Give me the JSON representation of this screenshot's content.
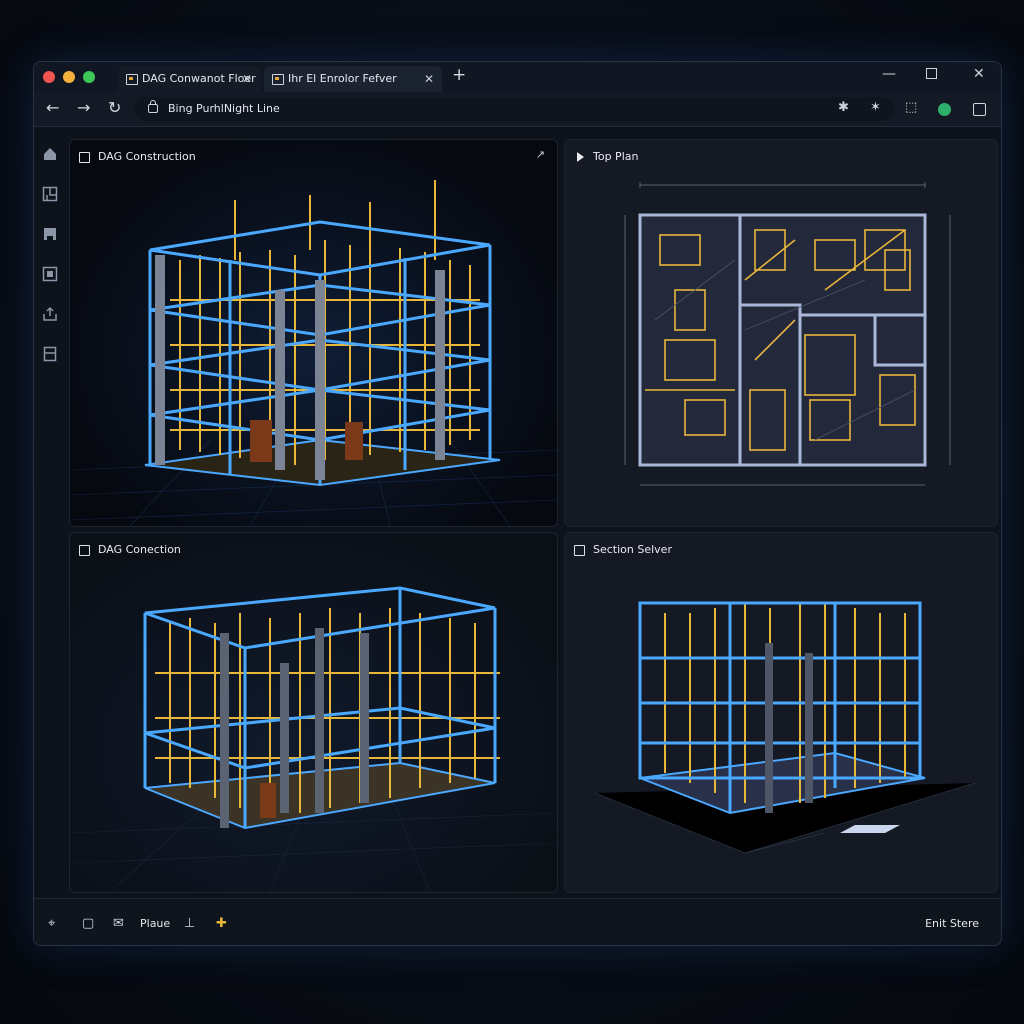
{
  "tabs": [
    {
      "label": "DAG Conwanot Floer"
    },
    {
      "label": "Ihr El Enrolor Fefver"
    }
  ],
  "toolbar": {
    "url": "Bing PurhlNight Line"
  },
  "panels": [
    {
      "title": "DAG Construction"
    },
    {
      "title": "Top Plan"
    },
    {
      "title": "DAG Conection"
    },
    {
      "title": "Section Selver"
    }
  ],
  "statusbar": {
    "label": "Plaue",
    "right_label": "Enit Stere"
  },
  "colors": {
    "accent_blue": "#4aa8ff",
    "accent_gold": "#e8b73a",
    "status_green": "#2fb06a"
  }
}
